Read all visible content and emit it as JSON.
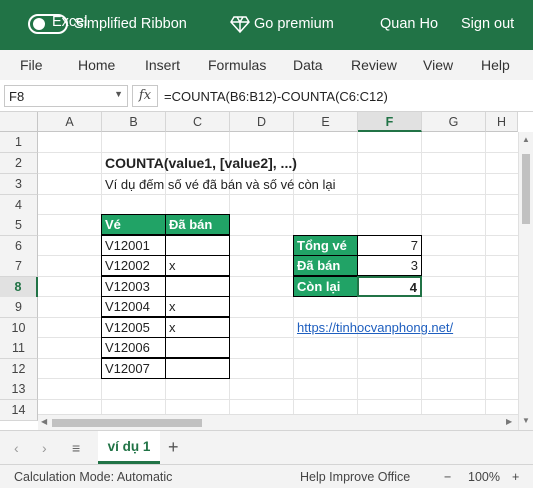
{
  "titlebar": {
    "app_name": "Excel",
    "ribbon_label": "Simplified Ribbon",
    "premium_label": "Go premium",
    "user_name": "Quan Ho",
    "signout_label": "Sign out"
  },
  "menu": [
    "File",
    "Home",
    "Insert",
    "Formulas",
    "Data",
    "Review",
    "View",
    "Help"
  ],
  "formula_bar": {
    "name_box": "F8",
    "fx_label": "fx",
    "formula": "=COUNTA(B6:B12)-COUNTA(C6:C12)"
  },
  "columns": [
    "A",
    "B",
    "C",
    "D",
    "E",
    "F",
    "G",
    "H"
  ],
  "rows": [
    "1",
    "2",
    "3",
    "4",
    "5",
    "6",
    "7",
    "8",
    "9",
    "10",
    "11",
    "12",
    "13",
    "14"
  ],
  "sheet": {
    "title": "COUNTA(value1, [value2], ...)",
    "subtitle": "Ví dụ đếm số vé đã bán và số vé còn lại",
    "table_headers": [
      "Vé",
      "Đã bán"
    ],
    "tickets": [
      {
        "ve": "V12001",
        "sold": ""
      },
      {
        "ve": "V12002",
        "sold": "x"
      },
      {
        "ve": "V12003",
        "sold": ""
      },
      {
        "ve": "V12004",
        "sold": "x"
      },
      {
        "ve": "V12005",
        "sold": "x"
      },
      {
        "ve": "V12006",
        "sold": ""
      },
      {
        "ve": "V12007",
        "sold": ""
      }
    ],
    "summary": [
      {
        "label": "Tổng vé",
        "value": "7"
      },
      {
        "label": "Đã bán",
        "value": "3"
      },
      {
        "label": "Còn lại",
        "value": "4"
      }
    ],
    "link": "https://tinhocvanphong.net/"
  },
  "tabs": {
    "sheet_name": "ví dụ 1"
  },
  "status": {
    "calc_mode": "Calculation Mode: Automatic",
    "help": "Help Improve Office",
    "zoom": "100%"
  },
  "colors": {
    "brand": "#217346",
    "table_header": "#21a366",
    "link": "#1f5fbf"
  }
}
